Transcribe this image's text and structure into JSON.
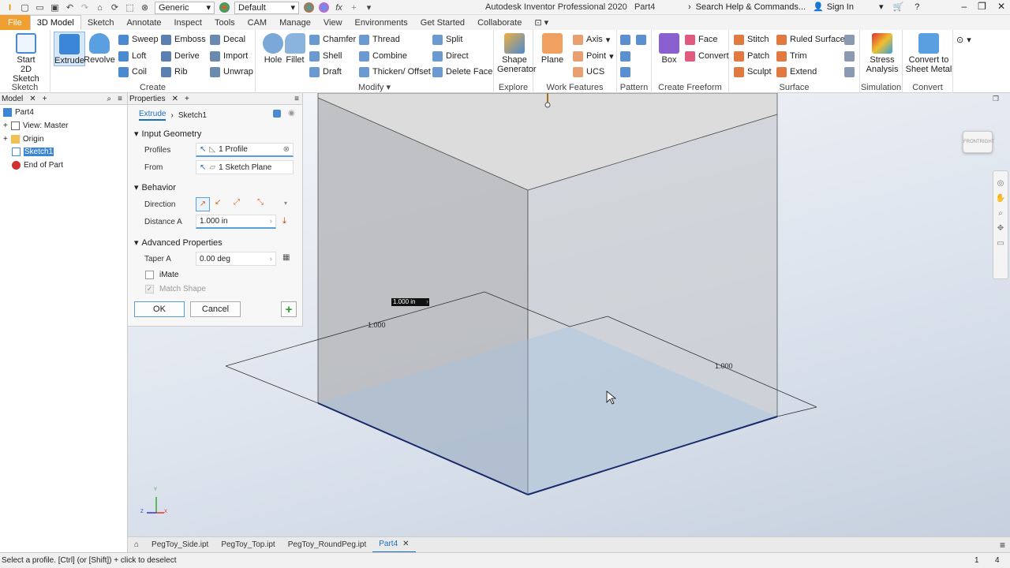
{
  "titlebar": {
    "style_combo": "Generic",
    "appearance_combo": "Default",
    "app_title": "Autodesk Inventor Professional 2020",
    "doc_title": "Part4",
    "help_search": "Search Help & Commands...",
    "signin": "Sign In"
  },
  "tabs": [
    "File",
    "3D Model",
    "Sketch",
    "Annotate",
    "Inspect",
    "Tools",
    "CAM",
    "Manage",
    "View",
    "Environments",
    "Get Started",
    "Collaborate"
  ],
  "ribbon": {
    "sketch": {
      "title": "Sketch",
      "start": "Start",
      "start2": "2D Sketch"
    },
    "create": {
      "title": "Create",
      "extrude": "Extrude",
      "revolve": "Revolve",
      "sweep": "Sweep",
      "loft": "Loft",
      "coil": "Coil",
      "emboss": "Emboss",
      "derive": "Derive",
      "rib": "Rib",
      "decal": "Decal",
      "import": "Import",
      "unwrap": "Unwrap"
    },
    "modify": {
      "title": "Modify",
      "hole": "Hole",
      "fillet": "Fillet",
      "chamfer": "Chamfer",
      "shell": "Shell",
      "draft": "Draft",
      "thread": "Thread",
      "combine": "Combine",
      "thicken": "Thicken/ Offset",
      "split": "Split",
      "direct": "Direct",
      "delete_face": "Delete Face"
    },
    "explore": {
      "title": "Explore",
      "shape": "Shape",
      "generator": "Generator"
    },
    "work": {
      "title": "Work Features",
      "plane": "Plane",
      "axis": "Axis",
      "point": "Point",
      "ucs": "UCS"
    },
    "pattern": {
      "title": "Pattern"
    },
    "freeform": {
      "title": "Create Freeform",
      "box": "Box",
      "face": "Face",
      "convert": "Convert"
    },
    "surface": {
      "title": "Surface",
      "stitch": "Stitch",
      "patch": "Patch",
      "sculpt": "Sculpt",
      "ruled": "Ruled Surface",
      "trim": "Trim",
      "extend": "Extend"
    },
    "simulation": {
      "title": "Simulation",
      "stress": "Stress",
      "analysis": "Analysis"
    },
    "convert": {
      "title": "Convert",
      "to_sheet": "Convert to",
      "sheet_metal": "Sheet Metal"
    }
  },
  "browser": {
    "tab": "Model",
    "items": [
      "Part4",
      "View: Master",
      "Origin",
      "Sketch1",
      "End of Part"
    ]
  },
  "properties": {
    "tab": "Properties",
    "breadcrumb_feature": "Extrude",
    "breadcrumb_sketch": "Sketch1",
    "input_geometry": "Input Geometry",
    "profiles_label": "Profiles",
    "profiles_value": "1 Profile",
    "from_label": "From",
    "from_value": "1 Sketch Plane",
    "behavior": "Behavior",
    "direction_label": "Direction",
    "distance_label": "Distance A",
    "distance_value": "1.000 in",
    "advanced": "Advanced Properties",
    "taper_label": "Taper A",
    "taper_value": "0.00 deg",
    "imate": "iMate",
    "match_shape": "Match Shape",
    "ok": "OK",
    "cancel": "Cancel"
  },
  "viewport": {
    "distance_edit": "1.000 in",
    "dim_left": "1.000",
    "dim_right": "1.000",
    "viewcube_front": "FRONT",
    "viewcube_right": "RIGHT",
    "axis_x": "X",
    "axis_y": "Y",
    "axis_z": "Z"
  },
  "doctabs": [
    "PegToy_Side.ipt",
    "PegToy_Top.ipt",
    "PegToy_RoundPeg.ipt",
    "Part4"
  ],
  "status": {
    "message": "Select a profile. [Ctrl] (or [Shift]) + click to deselect",
    "count1": "1",
    "count2": "4"
  }
}
